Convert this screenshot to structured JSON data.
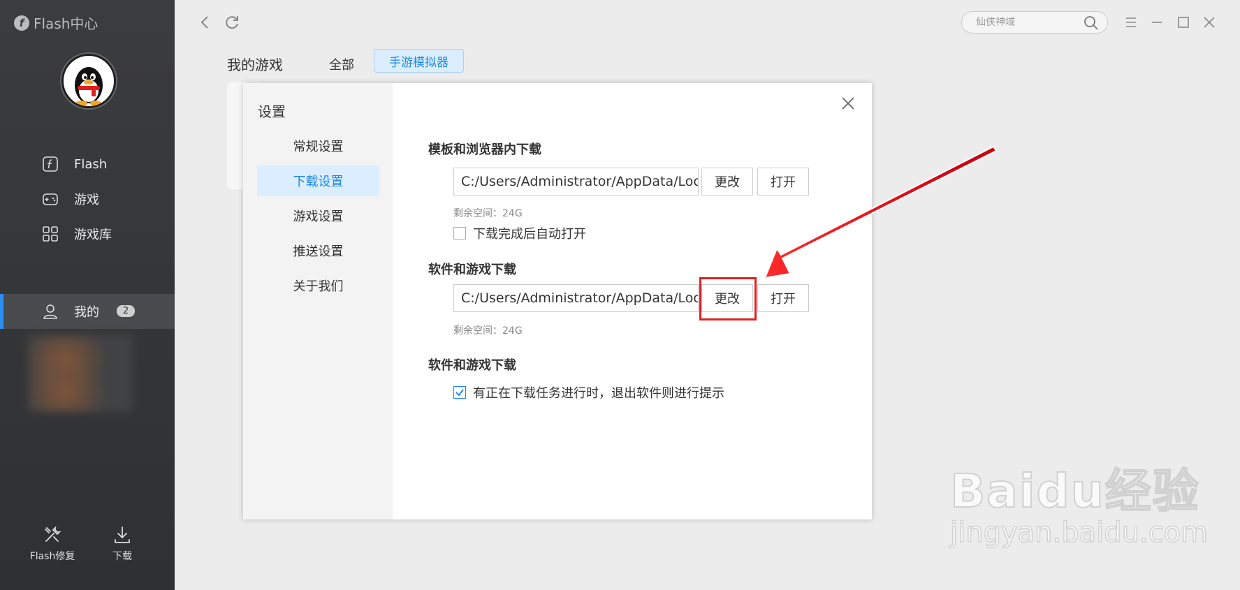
{
  "app": {
    "name": "Flash中心"
  },
  "sidebar": {
    "items": [
      {
        "label": "Flash",
        "icon": "flash-icon"
      },
      {
        "label": "游戏",
        "icon": "gamepad-icon"
      },
      {
        "label": "游戏库",
        "icon": "grid-icon"
      }
    ],
    "mine": {
      "label": "我的",
      "badge": "2",
      "icon": "user-icon"
    },
    "tools": [
      {
        "label": "Flash修复",
        "icon": "repair-icon"
      },
      {
        "label": "下载",
        "icon": "download-icon"
      }
    ],
    "accent": "#2b8ff0"
  },
  "topbar": {
    "search_placeholder": "仙侠神域"
  },
  "header": {
    "title": "我的游戏",
    "tabs": [
      {
        "label": "全部",
        "active": false
      },
      {
        "label": "手游模拟器",
        "active": true
      }
    ]
  },
  "dialog": {
    "title": "设置",
    "nav": [
      {
        "label": "常规设置",
        "active": false
      },
      {
        "label": "下载设置",
        "active": true
      },
      {
        "label": "游戏设置",
        "active": false
      },
      {
        "label": "推送设置",
        "active": false
      },
      {
        "label": "关于我们",
        "active": false
      }
    ],
    "sections": [
      {
        "title": "模板和浏览器内下载",
        "path": "C:/Users/Administrator/AppData/Local/",
        "change_label": "更改",
        "open_label": "打开",
        "space": "剩余空间：24G",
        "checkbox": {
          "label": "下载完成后自动打开",
          "checked": false
        }
      },
      {
        "title": "软件和游戏下载",
        "path": "C:/Users/Administrator/AppData/Local/",
        "change_label": "更改",
        "open_label": "打开",
        "space": "剩余空间：24G"
      },
      {
        "title": "软件和游戏下载",
        "checkbox": {
          "label": "有正在下载任务进行时，退出软件则进行提示",
          "checked": true
        }
      }
    ]
  },
  "watermark": {
    "main": "Baidu经验",
    "sub": "jingyan.baidu.com"
  },
  "colors": {
    "highlight": "#e02020",
    "arrow": "#e8141c",
    "active_tab_bg": "#dbeeff",
    "active_text": "#1e88e5"
  }
}
